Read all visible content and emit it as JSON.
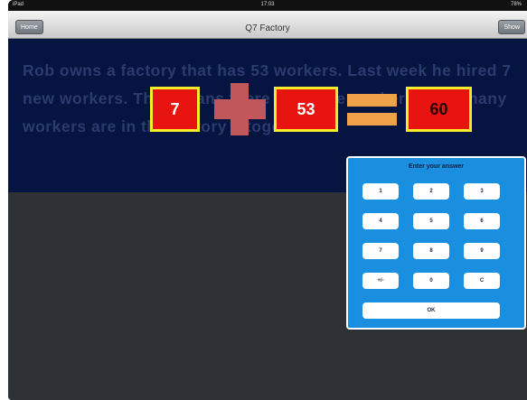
{
  "status": {
    "left": "iPad",
    "time": "17:03",
    "right": "78%"
  },
  "navbar": {
    "home_label": "Home",
    "title": "Q7 Factory",
    "show_label": "Show"
  },
  "question": {
    "text": "Rob owns a factory that has 53 workers. Last week he hired 7 new workers. This means there are more workers. How many workers are in the factory altogether"
  },
  "equation": {
    "addend1": "7",
    "addend2": "53",
    "result": "60"
  },
  "keypad": {
    "title": "Enter your answer",
    "keys": [
      "1",
      "2",
      "3",
      "4",
      "5",
      "6",
      "7",
      "8",
      "9",
      "+/-",
      "0",
      "C"
    ],
    "ok_label": "OK"
  },
  "colors": {
    "question_bg": "#061441",
    "box_fill": "#e8140f",
    "box_border": "#f6ee2a",
    "plus": "#c0575a",
    "equals": "#f0a24a",
    "keypad_bg": "#1a8fe0"
  }
}
